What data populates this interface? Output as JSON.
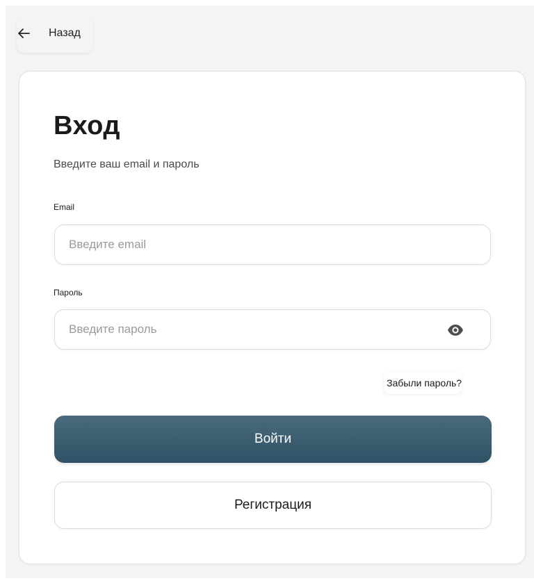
{
  "nav": {
    "back_label": "Назад",
    "back_icon": "arrow-left-icon"
  },
  "login": {
    "title": "Вход",
    "subtitle": "Введите ваш email и пароль",
    "email": {
      "label": "Email",
      "placeholder": "Введите email",
      "value": ""
    },
    "password": {
      "label": "Пароль",
      "placeholder": "Введите пароль",
      "value": "",
      "toggle_icon": "eye-icon"
    },
    "forgot_password": "Забыли пароль?",
    "submit_label": "Войти",
    "register_label": "Регистрация"
  },
  "colors": {
    "primary_button": "#3b5d70",
    "page_background": "#f4f4f4",
    "card_background": "#ffffff"
  }
}
